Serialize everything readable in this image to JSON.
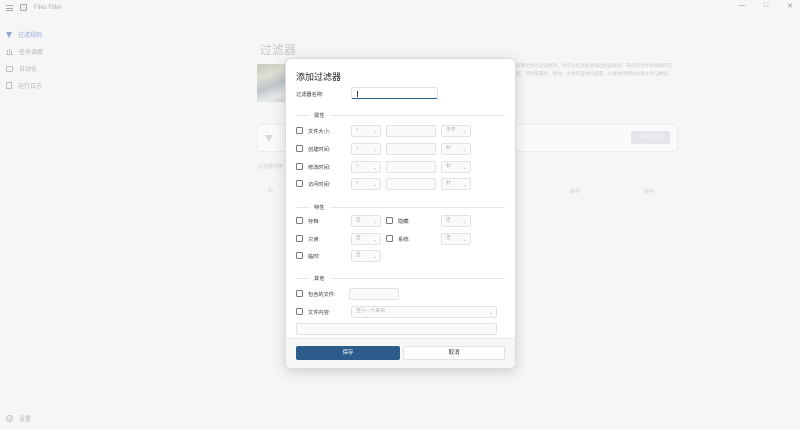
{
  "app": {
    "title": "Files Filter"
  },
  "window_controls": {
    "minimize": "—",
    "maximize": "□",
    "close": "✕"
  },
  "sidebar": {
    "items": [
      {
        "label": "过滤规则",
        "icon": "funnel-icon",
        "active": true
      },
      {
        "label": "任务调度",
        "icon": "bar-chart-icon",
        "active": false
      },
      {
        "label": "自动化",
        "icon": "monitor-icon",
        "active": false
      },
      {
        "label": "运行日志",
        "icon": "document-icon",
        "active": false
      }
    ],
    "settings_label": "设置"
  },
  "page": {
    "title": "过滤器",
    "description": "控制文件的过滤规则，你可以在此处新增过滤器规则，筛选的文件将按顺序匹配，可根据属性、特性、文件内容进行设置，以便更快捷地处理文件与数据。",
    "add_filter_label": "添加过滤器",
    "list_caption": "过滤器列表",
    "columns": {
      "id": "ID",
      "action": "操作",
      "operation": "操作"
    }
  },
  "dialog": {
    "title": "添加过滤器",
    "name_label": "过滤器名称:",
    "name_value": "",
    "sections": {
      "attributes": "属性",
      "features": "特性",
      "other": "其他"
    },
    "attribute_rows": [
      {
        "label": "文件大小:",
        "op": ">",
        "value": "",
        "unit": "字节"
      },
      {
        "label": "创建时间:",
        "op": ">",
        "value": "",
        "unit": "秒"
      },
      {
        "label": "修改时间:",
        "op": ">",
        "value": "",
        "unit": "秒"
      },
      {
        "label": "访问时间:",
        "op": ">",
        "value": "",
        "unit": "秒"
      }
    ],
    "feature_rows": [
      {
        "label": "存档:",
        "value": "否"
      },
      {
        "label": "隐藏:",
        "value": "否"
      },
      {
        "label": "只读:",
        "value": "否"
      },
      {
        "label": "系统:",
        "value": "否"
      },
      {
        "label": "临时:",
        "value": "否"
      }
    ],
    "other": {
      "include_files_label": "包含的文件:",
      "include_files_value": "",
      "file_content_label": "文件内容:",
      "file_content_placeholder": "至少一个单词",
      "extra_field_value": ""
    },
    "save_label": "保存",
    "cancel_label": "取消"
  }
}
